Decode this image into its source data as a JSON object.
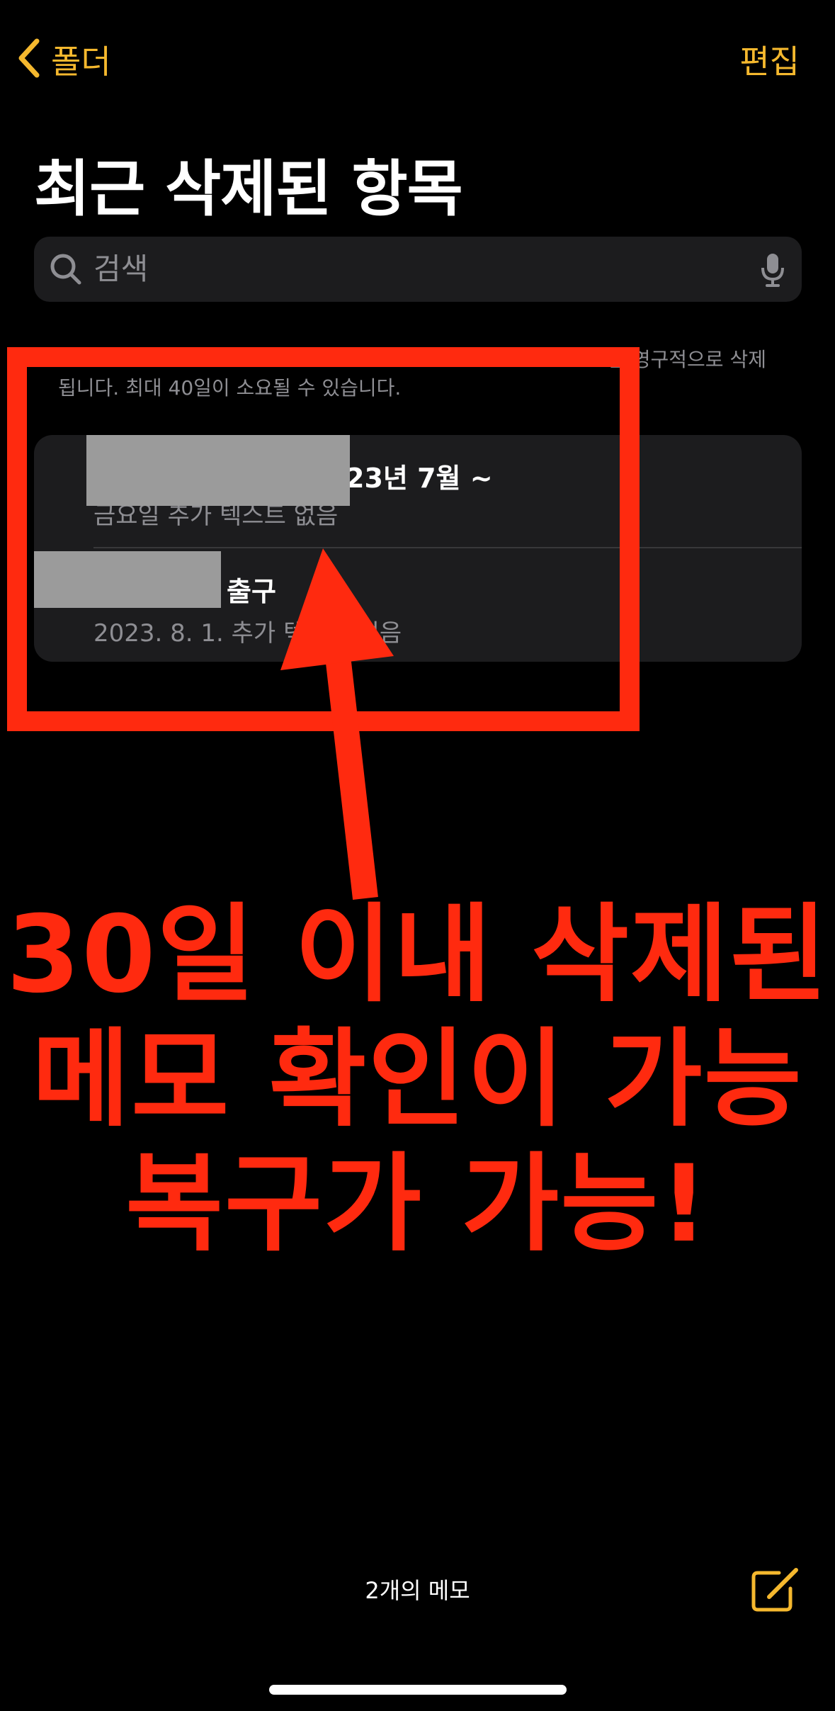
{
  "nav": {
    "back_label": "폴더",
    "edit_label": "편집"
  },
  "page_title": "최근 삭제된 항목",
  "search": {
    "placeholder": "검색",
    "icon": "search-icon",
    "mic_icon": "microphone-icon"
  },
  "info": {
    "line1": "는 영구적으로 삭제",
    "line2": "됩니다. 최대 40일이 소요될 수 있습니다."
  },
  "notes": [
    {
      "title_visible": "23년  7월 ~",
      "subtitle": "금요일  추가 텍스트 없음",
      "redacted": true
    },
    {
      "title_visible": "출구",
      "subtitle": "2023. 8. 1.  추가 텍스트 없음",
      "redacted": true
    }
  ],
  "annotation": {
    "line1": "30일 이내 삭제된",
    "line2": "메모 확인이 가능",
    "line3": "복구가 가능!"
  },
  "footer": {
    "count_label": "2개의 메모",
    "compose_icon": "compose-icon"
  },
  "colors": {
    "accent": "#F5B82E",
    "annotation": "#FF2A0F",
    "background": "#000000",
    "card": "#1C1C1E",
    "secondary_text": "#8E8E93"
  }
}
